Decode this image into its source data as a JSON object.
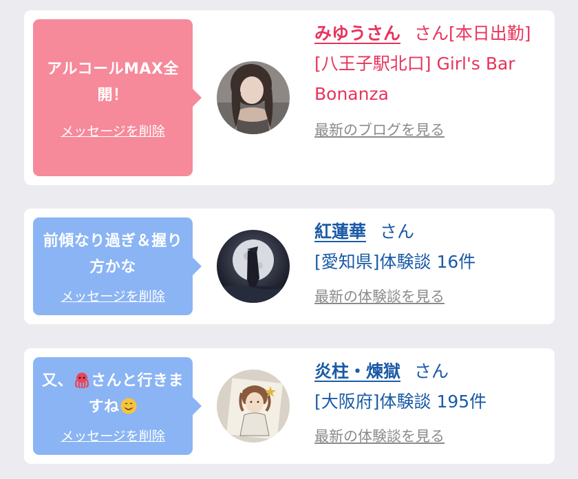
{
  "items": [
    {
      "message": "アルコールMAX全開！",
      "delete_label": "メッセージを削除",
      "name": "みゆうさん",
      "name_suffix": "さん[本日出勤]",
      "detail": "[八王子駅北口] Girl's Bar Bonanza",
      "more_label": "最新のブログを見る",
      "bubble_color": "#f6899a",
      "text_color": "#e8335b"
    },
    {
      "message": "前傾なり過ぎ＆握り方かな",
      "delete_label": "メッセージを削除",
      "name": "紅蓮華",
      "name_suffix": "さん",
      "detail": "[愛知県]体験談 16件",
      "more_label": "最新の体験談を見る",
      "bubble_color": "#8ab4f4",
      "text_color": "#1a5aa6"
    },
    {
      "message_before": "又、",
      "message_emoji": "octopus-emoji",
      "message_after": "さんと行きますね",
      "message_end_emoji": "smiling-face-emoji",
      "delete_label": "メッセージを削除",
      "name": "炎柱・煉獄",
      "name_suffix": "さん",
      "detail": "[大阪府]体験談 195件",
      "more_label": "最新の体験談を見る",
      "bubble_color": "#8ab4f4",
      "text_color": "#1a5aa6"
    }
  ]
}
